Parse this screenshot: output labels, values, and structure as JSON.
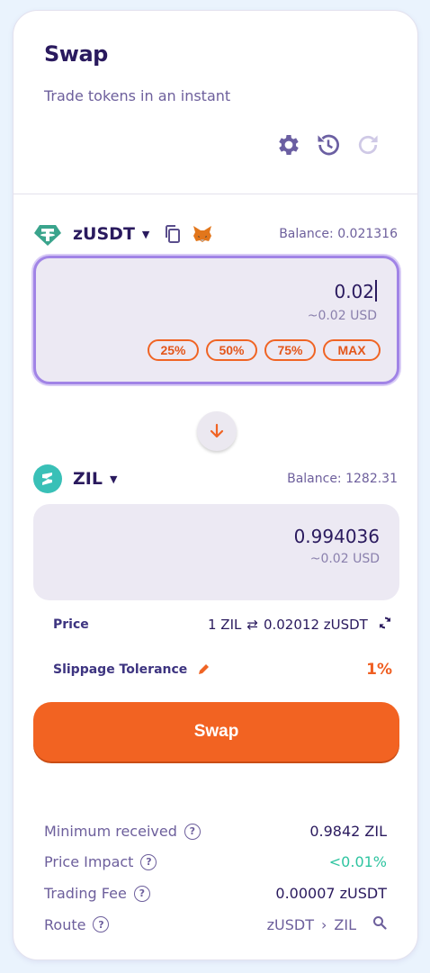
{
  "header": {
    "title": "Swap",
    "subtitle": "Trade tokens in an instant",
    "icons": [
      "gear-icon",
      "history-icon",
      "refresh-icon"
    ]
  },
  "from": {
    "token": "zUSDT",
    "balance": "Balance: 0.021316",
    "amount": "0.02",
    "usd": "~0.02 USD",
    "percents": [
      "25%",
      "50%",
      "75%",
      "MAX"
    ]
  },
  "to": {
    "token": "ZIL",
    "balance": "Balance: 1282.31",
    "amount": "0.994036",
    "usd": "~0.02 USD"
  },
  "price": {
    "label": "Price",
    "left": "1 ZIL",
    "right": "0.02012 zUSDT"
  },
  "slippage": {
    "label": "Slippage Tolerance",
    "value": "1%"
  },
  "swap_button": "Swap",
  "details": {
    "min_received_label": "Minimum received",
    "min_received_value": "0.9842 ZIL",
    "price_impact_label": "Price Impact",
    "price_impact_value": "<0.01%",
    "trading_fee_label": "Trading Fee",
    "trading_fee_value": "0.00007 zUSDT",
    "route_label": "Route",
    "route_from": "zUSDT",
    "route_sep": "›",
    "route_to": "ZIL"
  },
  "colors": {
    "accent": "#f26322",
    "primary_text": "#2a1a5e",
    "muted_text": "#6d5f9c",
    "active_border": "#a184e6",
    "positive": "#2ec4a0"
  }
}
